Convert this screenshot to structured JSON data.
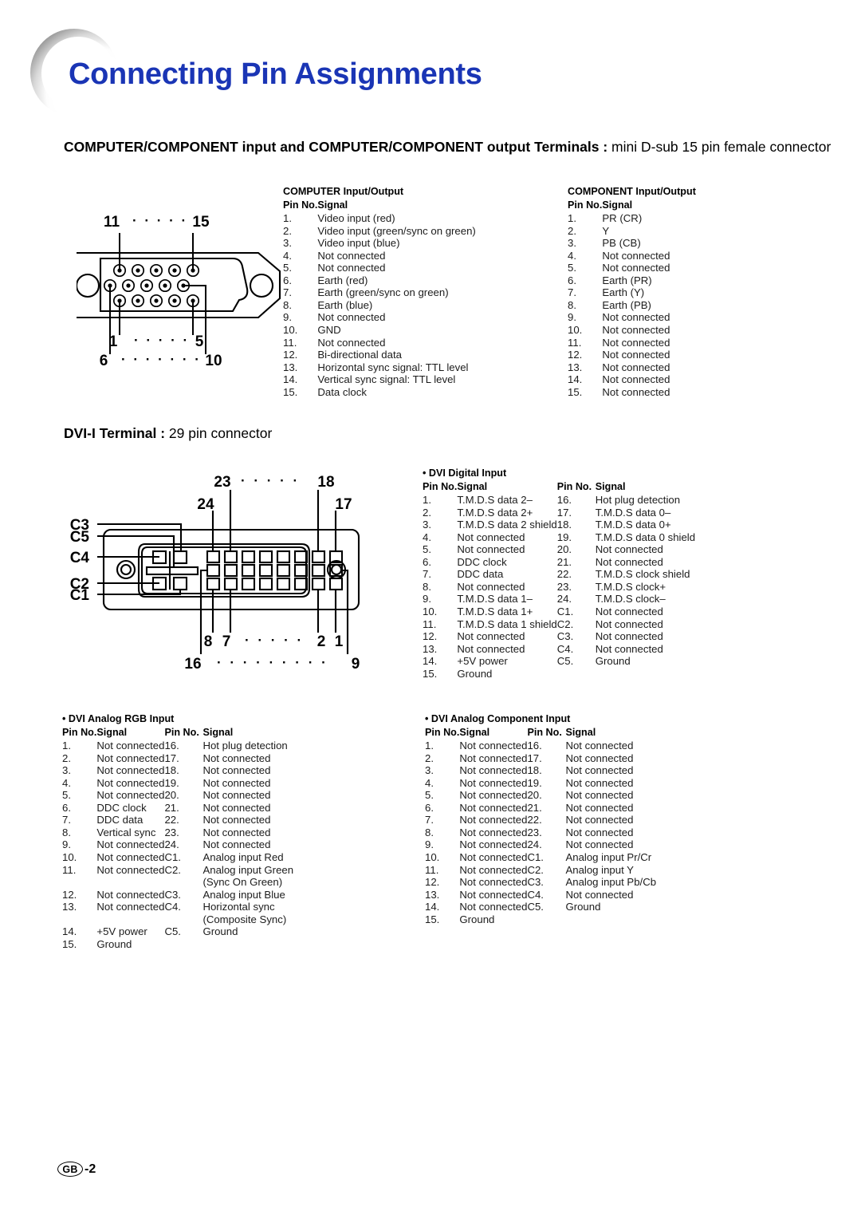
{
  "document": {
    "title": "Connecting Pin Assignments",
    "title_color": "#1a35b5",
    "footer": {
      "region_code": "GB",
      "page_number": "-2"
    }
  },
  "sections": [
    {
      "id": "computer-component",
      "heading_bold": "COMPUTER/COMPONENT input and COMPUTER/COMPONENT output Terminals :",
      "heading_normal": " mini D-sub 15 pin female connector",
      "connector_diagram": {
        "name": "d-sub-15-female-connector",
        "rows": 3,
        "pins_per_row": 5,
        "labels": {
          "top_left": "11",
          "top_right": "15",
          "mid_left": "6",
          "mid_right": "10",
          "bottom_left": "1",
          "bottom_right": "5",
          "top_dots": "· · · · ·",
          "bottom_dots": "· · · · ·",
          "mid_dots": "· · · · · · ·"
        }
      }
    },
    {
      "id": "dvi-i",
      "heading_bold": "DVI-I Terminal :",
      "heading_normal": " 29 pin connector",
      "connector_diagram": {
        "name": "dvi-i-29-pin-connector",
        "rows": 3,
        "pins_per_row": 8,
        "labels": {
          "l24": "24",
          "l23": "23",
          "l18": "18",
          "l17": "17",
          "l8": "8",
          "l7": "7",
          "l2": "2",
          "l1": "1",
          "l16": "16",
          "l9": "9",
          "c1": "C1",
          "c2": "C2",
          "c3": "C3",
          "c4": "C4",
          "c5": "C5",
          "top_dots": "· · · · ·",
          "bottom_dots": "· · · · ·",
          "lower_dots": "· · · · · · · · ·"
        }
      }
    }
  ],
  "tables": {
    "computer_io": {
      "title": "COMPUTER Input/Output",
      "headers": {
        "pin": "Pin No.",
        "signal": "Signal"
      },
      "rows": [
        [
          "1.",
          "Video input (red)"
        ],
        [
          "2.",
          "Video input (green/sync on green)"
        ],
        [
          "3.",
          "Video input (blue)"
        ],
        [
          "4.",
          "Not connected"
        ],
        [
          "5.",
          "Not connected"
        ],
        [
          "6.",
          "Earth (red)"
        ],
        [
          "7.",
          "Earth (green/sync on green)"
        ],
        [
          "8.",
          "Earth (blue)"
        ],
        [
          "9.",
          "Not connected"
        ],
        [
          "10.",
          "GND"
        ],
        [
          "11.",
          "Not connected"
        ],
        [
          "12.",
          "Bi-directional data"
        ],
        [
          "13.",
          "Horizontal sync signal: TTL level"
        ],
        [
          "14.",
          "Vertical sync signal: TTL level"
        ],
        [
          "15.",
          "Data clock"
        ]
      ]
    },
    "component_io": {
      "title": "COMPONENT Input/Output",
      "headers": {
        "pin": "Pin No.",
        "signal": "Signal"
      },
      "rows": [
        [
          "1.",
          "PR (CR)"
        ],
        [
          "2.",
          "Y"
        ],
        [
          "3.",
          "PB (CB)"
        ],
        [
          "4.",
          "Not connected"
        ],
        [
          "5.",
          "Not connected"
        ],
        [
          "6.",
          "Earth (PR)"
        ],
        [
          "7.",
          "Earth (Y)"
        ],
        [
          "8.",
          "Earth (PB)"
        ],
        [
          "9.",
          "Not connected"
        ],
        [
          "10.",
          "Not connected"
        ],
        [
          "11.",
          "Not connected"
        ],
        [
          "12.",
          "Not connected"
        ],
        [
          "13.",
          "Not connected"
        ],
        [
          "14.",
          "Not connected"
        ],
        [
          "15.",
          "Not connected"
        ]
      ]
    },
    "dvi_digital_input": {
      "title": "DVI Digital Input",
      "headers": {
        "pin": "Pin No.",
        "signal": "Signal",
        "pin2": "Pin No.",
        "signal2": "Signal"
      },
      "rows": [
        [
          "1.",
          "T.M.D.S data 2–",
          "16.",
          "Hot plug detection"
        ],
        [
          "2.",
          "T.M.D.S data 2+",
          "17.",
          "T.M.D.S data 0–"
        ],
        [
          "3.",
          "T.M.D.S data 2 shield",
          "18.",
          "T.M.D.S data 0+"
        ],
        [
          "4.",
          "Not connected",
          "19.",
          "T.M.D.S data 0 shield"
        ],
        [
          "5.",
          "Not connected",
          "20.",
          "Not connected"
        ],
        [
          "6.",
          "DDC clock",
          "21.",
          "Not connected"
        ],
        [
          "7.",
          "DDC data",
          "22.",
          "T.M.D.S clock shield"
        ],
        [
          "8.",
          "Not connected",
          "23.",
          "T.M.D.S clock+"
        ],
        [
          "9.",
          "T.M.D.S data 1–",
          "24.",
          "T.M.D.S clock–"
        ],
        [
          "10.",
          "T.M.D.S data 1+",
          "C1.",
          "Not connected"
        ],
        [
          "11.",
          "T.M.D.S data 1 shield",
          "C2.",
          "Not connected"
        ],
        [
          "12.",
          "Not connected",
          "C3.",
          "Not connected"
        ],
        [
          "13.",
          "Not connected",
          "C4.",
          "Not connected"
        ],
        [
          "14.",
          "+5V power",
          "C5.",
          "Ground"
        ],
        [
          "15.",
          "Ground",
          "",
          ""
        ]
      ]
    },
    "dvi_analog_rgb_input": {
      "title": "DVI Analog RGB Input",
      "headers": {
        "pin": "Pin No.",
        "signal": "Signal",
        "pin2": "Pin No.",
        "signal2": "Signal"
      },
      "rows": [
        [
          "1.",
          "Not connected",
          "16.",
          "Hot plug detection"
        ],
        [
          "2.",
          "Not connected",
          "17.",
          "Not connected"
        ],
        [
          "3.",
          "Not connected",
          "18.",
          "Not connected"
        ],
        [
          "4.",
          "Not connected",
          "19.",
          "Not connected"
        ],
        [
          "5.",
          "Not connected",
          "20.",
          "Not connected"
        ],
        [
          "6.",
          "DDC clock",
          "21.",
          "Not connected"
        ],
        [
          "7.",
          "DDC data",
          "22.",
          "Not connected"
        ],
        [
          "8.",
          "Vertical sync",
          "23.",
          "Not connected"
        ],
        [
          "9.",
          "Not connected",
          "24.",
          "Not connected"
        ],
        [
          "10.",
          "Not connected",
          "C1.",
          "Analog input Red"
        ],
        [
          "11.",
          "Not connected",
          "C2.",
          "Analog input Green"
        ],
        [
          "",
          "",
          "",
          "(Sync On Green)"
        ],
        [
          "12.",
          "Not connected",
          "C3.",
          "Analog input Blue"
        ],
        [
          "13.",
          "Not connected",
          "C4.",
          "Horizontal sync"
        ],
        [
          "",
          "",
          "",
          "(Composite Sync)"
        ],
        [
          "14.",
          "+5V power",
          "C5.",
          "Ground"
        ],
        [
          "15.",
          "Ground",
          "",
          ""
        ]
      ]
    },
    "dvi_analog_component_input": {
      "title": "DVI Analog Component Input",
      "headers": {
        "pin": "Pin No.",
        "signal": "Signal",
        "pin2": "Pin No.",
        "signal2": "Signal"
      },
      "rows": [
        [
          "1.",
          "Not connected",
          "16.",
          "Not connected"
        ],
        [
          "2.",
          "Not connected",
          "17.",
          "Not connected"
        ],
        [
          "3.",
          "Not connected",
          "18.",
          "Not connected"
        ],
        [
          "4.",
          "Not connected",
          "19.",
          "Not connected"
        ],
        [
          "5.",
          "Not connected",
          "20.",
          "Not connected"
        ],
        [
          "6.",
          "Not connected",
          "21.",
          "Not connected"
        ],
        [
          "7.",
          "Not connected",
          "22.",
          "Not connected"
        ],
        [
          "8.",
          "Not connected",
          "23.",
          "Not connected"
        ],
        [
          "9.",
          "Not connected",
          "24.",
          "Not connected"
        ],
        [
          "10.",
          "Not connected",
          "C1.",
          "Analog input Pr/Cr"
        ],
        [
          "11.",
          "Not connected",
          "C2.",
          "Analog input Y"
        ],
        [
          "12.",
          "Not connected",
          "C3.",
          "Analog input Pb/Cb"
        ],
        [
          "13.",
          "Not connected",
          "C4.",
          "Not connected"
        ],
        [
          "14.",
          "Not connected",
          "C5.",
          "Ground"
        ],
        [
          "15.",
          "Ground",
          "",
          ""
        ]
      ]
    }
  }
}
